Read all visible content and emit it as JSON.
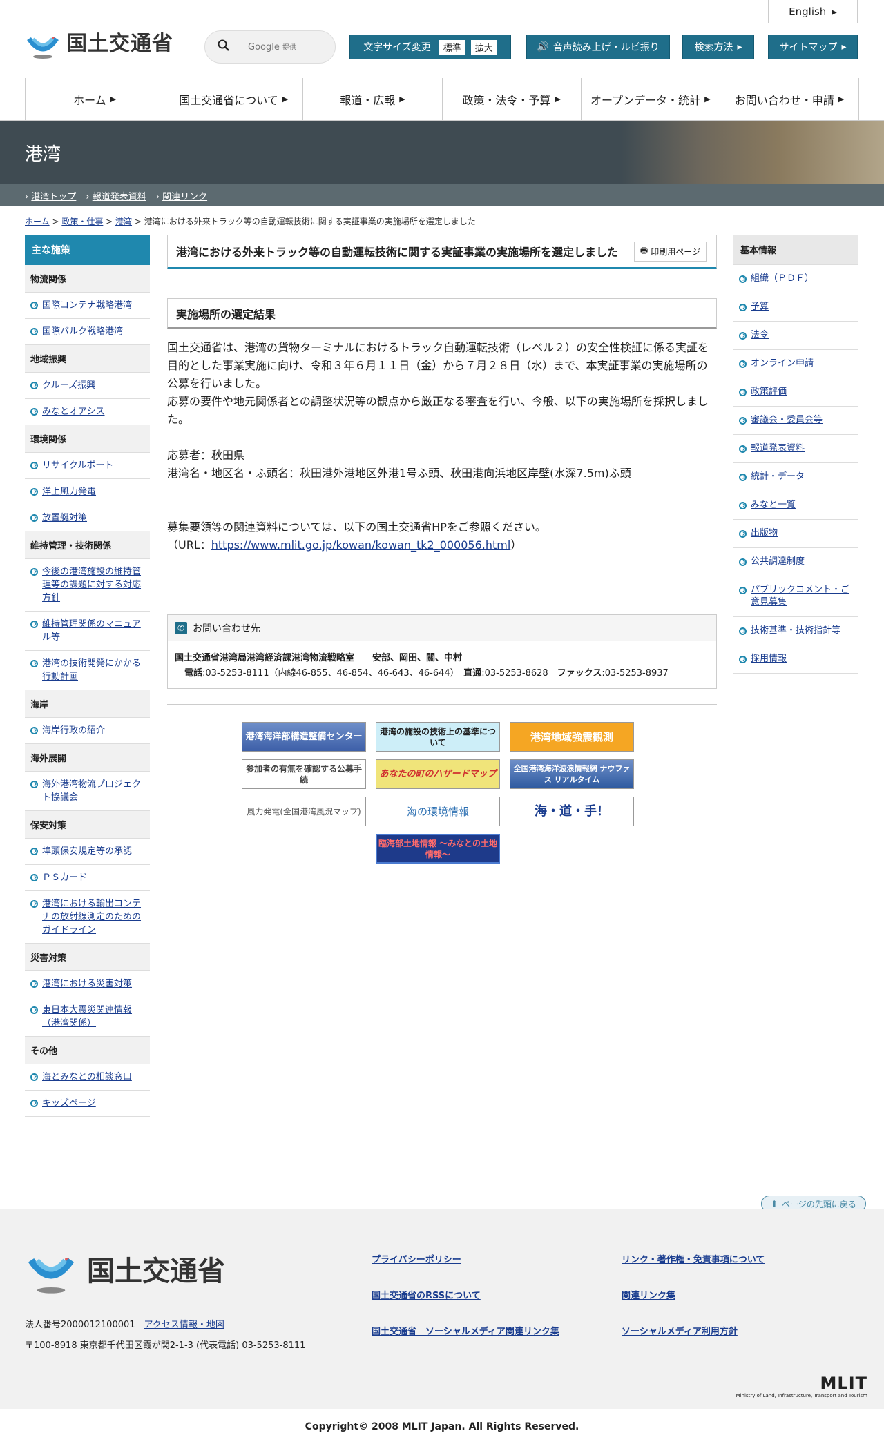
{
  "header": {
    "logo_text": "国土交通省",
    "search_brand": "Google",
    "search_suffix": "提供",
    "english": "English",
    "fontsize_label": "文字サイズ変更",
    "fontsize_standard": "標準",
    "fontsize_large": "拡大",
    "speech_label": "音声読み上げ・ルビ振り",
    "search_method": "検索方法",
    "sitemap": "サイトマップ"
  },
  "nav": [
    "ホーム",
    "国土交通省について",
    "報道・広報",
    "政策・法令・予算",
    "オープンデータ・統計",
    "お問い合わせ・申請"
  ],
  "banner": {
    "title": "港湾"
  },
  "subnav": [
    "港湾トップ",
    "報道発表資料",
    "関連リンク"
  ],
  "breadcrumb": {
    "home": "ホーム",
    "policy": "政策・仕事",
    "port": "港湾",
    "current": "港湾における外来トラック等の自動運転技術に関する実証事業の実施場所を選定しました"
  },
  "left": {
    "heading": "主な施策",
    "groups": [
      {
        "title": "物流関係",
        "items": [
          "国際コンテナ戦略港湾",
          "国際バルク戦略港湾"
        ]
      },
      {
        "title": "地域振興",
        "items": [
          "クルーズ振興",
          "みなとオアシス"
        ]
      },
      {
        "title": "環境関係",
        "items": [
          "リサイクルポート",
          "洋上風力発電",
          "放置艇対策"
        ]
      },
      {
        "title": "維持管理・技術関係",
        "items": [
          "今後の港湾施設の維持管理等の課題に対する対応方針",
          "維持管理関係のマニュアル等",
          "港湾の技術開発にかかる行動計画"
        ]
      },
      {
        "title": "海岸",
        "items": [
          "海岸行政の紹介"
        ]
      },
      {
        "title": "海外展開",
        "items": [
          "海外港湾物流プロジェクト協議会"
        ]
      },
      {
        "title": "保安対策",
        "items": [
          "埠頭保安規定等の承認",
          "ＰＳカード",
          "港湾における輸出コンテナの放射線測定のためのガイドライン"
        ]
      },
      {
        "title": "災害対策",
        "items": [
          "港湾における災害対策",
          "東日本大震災関連情報（港湾関係）"
        ]
      },
      {
        "title": "その他",
        "items": [
          "海とみなとの相談窓口",
          "キッズページ"
        ]
      }
    ]
  },
  "main": {
    "title": "港湾における外来トラック等の自動運転技術に関する実証事業の実施場所を選定しました",
    "print": "印刷用ページ",
    "section": "実施場所の選定結果",
    "p1": "国土交通省は、港湾の貨物ターミナルにおけるトラック自動運転技術（レベル２）の安全性検証に係る実証を目的とした事業実施に向け、令和３年６月１１日（金）から７月２８日（水）まで、本実証事業の実施場所の公募を行いました。",
    "p2": "応募の要件や地元関係者との調整状況等の観点から厳正なる審査を行い、今般、以下の実施場所を採択しました。",
    "applicant": "応募者：秋田県",
    "location": "港湾名・地区名・ふ頭名：秋田港外港地区外港1号ふ頭、秋田港向浜地区岸壁(水深7.5m)ふ頭",
    "ref": "募集要領等の関連資料については、以下の国土交通省HPをご参照ください。",
    "url_prefix": "（URL：",
    "url": "https://www.mlit.go.jp/kowan/kowan_tk2_000056.html",
    "url_suffix": "）",
    "contact_head": "お問い合わせ先",
    "contact_org": "国土交通省港湾局港湾経済課港湾物流戦略室　　安部、岡田、關、中村",
    "contact_tel_label": "電話",
    "contact_tel": ":03-5253-8111（内線46-855、46-854、46-643、46-644）",
    "contact_direct_label": "直通",
    "contact_direct": ":03-5253-8628",
    "contact_fax_label": "ファックス",
    "contact_fax": ":03-5253-8937",
    "banners": [
      "港湾海洋部構造整備センター",
      "港湾の施設の技術上の基準について",
      "港湾地域強震観測",
      "参加者の有無を確認する公募手続",
      "あなたの町のハザードマップ",
      "全国港湾海洋波浪情報網 ナウファス リアルタイム",
      "風力発電(全国港湾風況マップ)",
      "海の環境情報",
      "海・道・手！",
      "臨海部土地情報 ～みなとの土地情報～"
    ]
  },
  "right": {
    "heading": "基本情報",
    "items": [
      "組織（ＰＤＦ）",
      "予算",
      "法令",
      "オンライン申請",
      "政策評価",
      "審議会・委員会等",
      "報道発表資料",
      "統計・データ",
      "みなと一覧",
      "出版物",
      "公共調達制度",
      "パブリックコメント・ご意見募集",
      "技術基準・技術指針等",
      "採用情報"
    ]
  },
  "pagetop": "ページの先頭に戻る",
  "footer": {
    "logo_text": "国土交通省",
    "corp_number": "法人番号2000012100001",
    "access": "アクセス情報・地図",
    "address": "〒100-8918 東京都千代田区霞が関2-1-3 (代表電話) 03-5253-8111",
    "links": [
      "プライバシーポリシー",
      "リンク・著作権・免責事項について",
      "国土交通省のRSSについて",
      "関連リンク集",
      "国土交通省　ソーシャルメディア関連リンク集",
      "ソーシャルメディア利用方針"
    ],
    "mlit": "MLIT",
    "mlit_sub": "Ministry of Land, Infrastructure, Transport and Tourism",
    "copyright": "Copyright© 2008 MLIT Japan. All Rights Reserved."
  },
  "colors": {
    "accent": "#1f88ae",
    "header_btn": "#1f6e8a",
    "banner": "#3f4b52",
    "link": "#1a3d8f"
  }
}
